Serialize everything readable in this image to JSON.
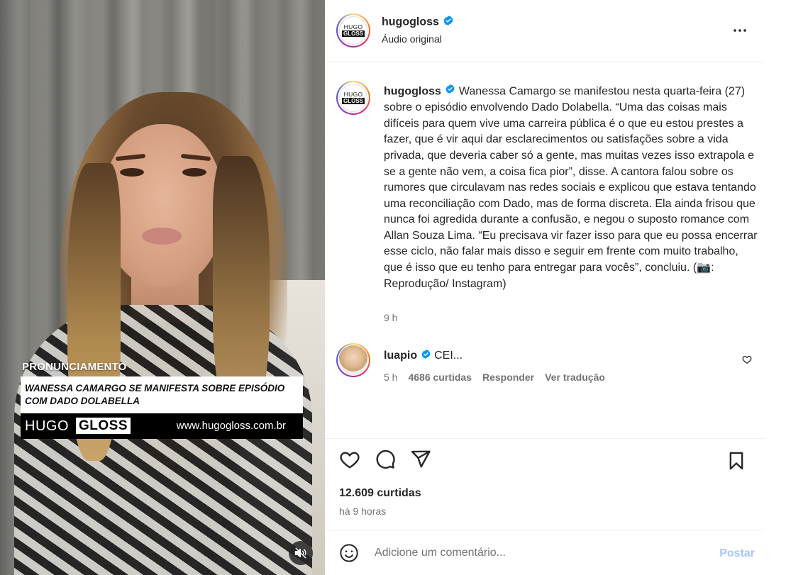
{
  "video": {
    "overlay_kicker": "PRONUNCIAMENTO",
    "overlay_headline_line1": "WANESSA CAMARGO SE MANIFESTA SOBRE EPISÓDIO",
    "overlay_headline_line2": "COM DADO DOLABELLA",
    "brand_hugo": "HUGO",
    "brand_gloss": "GLOSS",
    "brand_url": "www.hugogloss.com.br",
    "mute_icon": "speaker-muted-icon"
  },
  "header": {
    "username": "hugogloss",
    "audio": "Áudio original",
    "avatar_text_top": "HUGO",
    "avatar_text_bottom": "GLOSS",
    "more_icon": "more-horizontal-icon"
  },
  "caption": {
    "username": "hugogloss",
    "text": "Wanessa Camargo se manifestou nesta quarta-feira (27) sobre o episódio envolvendo Dado Dolabella. “Uma das coisas mais difíceis para quem vive uma carreira pública é o que eu estou prestes a fazer, que é vir aqui dar esclarecimentos ou satisfações sobre a vida privada, que deveria caber só a gente, mas muitas vezes isso extrapola e se a gente não vem, a coisa fica pior”, disse. A cantora falou sobre os rumores que circulavam nas redes sociais e explicou que estava tentando uma reconciliação com Dado, mas de forma discreta. Ela ainda frisou que nunca foi agredida durante a confusão, e negou o suposto romance com Allan Souza Lima. “Eu precisava vir fazer isso para que eu possa encerrar esse ciclo, não falar mais disso e seguir em frente com muito trabalho, que é isso que eu tenho para entregar para vocês”, concluiu. (📷: Reprodução/ Instagram)",
    "time": "9 h"
  },
  "comment": {
    "username": "luapio",
    "text": "CEI...",
    "time": "5 h",
    "likes": "4686 curtidas",
    "reply": "Responder",
    "translate": "Ver tradução"
  },
  "actions": {
    "likes": "12.609 curtidas",
    "posted_ago": "há 9 horas"
  },
  "comment_box": {
    "placeholder": "Adicione um comentário...",
    "post_label": "Postar"
  },
  "colors": {
    "verified": "#0095f6",
    "post_button_disabled": "#a5c8f7",
    "secondary_text": "#737373"
  }
}
